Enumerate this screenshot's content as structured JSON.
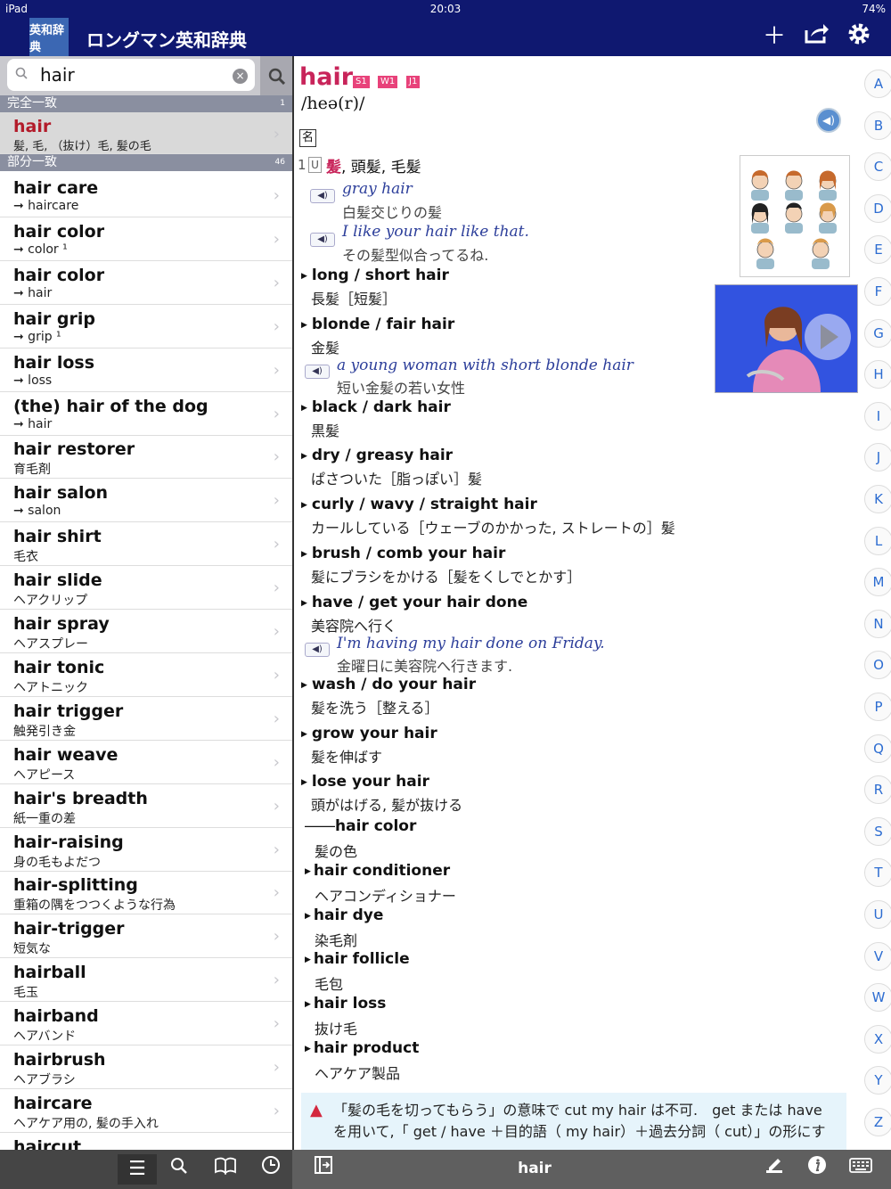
{
  "status": {
    "device": "iPad",
    "time": "20:03",
    "battery": "74%"
  },
  "nav": {
    "logo": "英和辞典",
    "title": "ロングマン英和辞典"
  },
  "search": {
    "value": "hair"
  },
  "sections": {
    "exact": {
      "label": "完全一致",
      "count": "1"
    },
    "partial": {
      "label": "部分一致",
      "count": "46"
    }
  },
  "exact_item": {
    "word": "hair",
    "meaning": "髪, 毛, （抜け）毛, 髪の毛"
  },
  "list": [
    {
      "word": "hair care",
      "meaning": "➞ haircare"
    },
    {
      "word": "hair color",
      "meaning": "➞ color ¹"
    },
    {
      "word": "hair color",
      "meaning": "➞ hair"
    },
    {
      "word": "hair grip",
      "meaning": "➞ grip ¹"
    },
    {
      "word": "hair loss",
      "meaning": "➞ loss"
    },
    {
      "word": "(the) hair of the dog",
      "meaning": "➞ hair"
    },
    {
      "word": "hair restorer",
      "meaning": "育毛剤"
    },
    {
      "word": "hair salon",
      "meaning": "➞ salon"
    },
    {
      "word": "hair shirt",
      "meaning": "毛衣"
    },
    {
      "word": "hair slide",
      "meaning": "ヘアクリップ"
    },
    {
      "word": "hair spray",
      "meaning": "ヘアスプレー"
    },
    {
      "word": "hair tonic",
      "meaning": "ヘアトニック"
    },
    {
      "word": "hair trigger",
      "meaning": "触発引き金"
    },
    {
      "word": "hair weave",
      "meaning": "ヘアピース"
    },
    {
      "word": "hair's breadth",
      "meaning": "紙一重の差"
    },
    {
      "word": "hair-raising",
      "meaning": "身の毛もよだつ"
    },
    {
      "word": "hair-splitting",
      "meaning": "重箱の隅をつつくような行為"
    },
    {
      "word": "hair-trigger",
      "meaning": "短気な"
    },
    {
      "word": "hairball",
      "meaning": "毛玉"
    },
    {
      "word": "hairband",
      "meaning": "ヘアバンド"
    },
    {
      "word": "hairbrush",
      "meaning": "ヘアブラシ"
    },
    {
      "word": "haircare",
      "meaning": "ヘアケア用の, 髪の手入れ"
    },
    {
      "word": "haircut",
      "meaning": ""
    }
  ],
  "entry": {
    "headword": "hair",
    "badges": [
      "S1",
      "W1",
      "J1"
    ],
    "pron": "/heə(r)/",
    "pos": "名",
    "sense_num": "1",
    "sense_u": "U",
    "sense_key": "髪",
    "sense_rest": ", 頭髪, 毛髪",
    "ex1_en": "gray hair",
    "ex1_jp": "白髪交じりの髪",
    "ex2_en": "I like your hair like that.",
    "ex2_jp": "その髪型似合ってるね.",
    "phrases": [
      {
        "en": "long / short hair",
        "jp": "長髪［短髪］"
      },
      {
        "en": "blonde / fair hair",
        "jp": "金髪"
      },
      {
        "en": "black / dark hair",
        "jp": "黒髪"
      },
      {
        "en": "dry / greasy hair",
        "jp": "ぱさついた［脂っぽい］髪"
      },
      {
        "en": "curly / wavy / straight hair",
        "jp": "カールしている［ウェーブのかかった, ストレートの］髪"
      },
      {
        "en": "brush / comb your hair",
        "jp": "髪にブラシをかける［髪をくしでとかす］"
      },
      {
        "en": "have / get your hair done",
        "jp": "美容院へ行く"
      },
      {
        "en": "wash / do your hair",
        "jp": "髪を洗う［整える］"
      },
      {
        "en": "grow your hair",
        "jp": "髪を伸ばす"
      },
      {
        "en": "lose your hair",
        "jp": "頭がはげる, 髪が抜ける"
      }
    ],
    "ex3_en": "a young woman with short blonde hair",
    "ex3_jp": "短い金髪の若い女性",
    "ex4_en": "I'm having my hair done on Friday.",
    "ex4_jp": "金曜日に美容院へ行きます.",
    "compound_dash": "――",
    "compounds": [
      {
        "en": "hair color",
        "jp": "髪の色"
      },
      {
        "en": "hair conditioner",
        "jp": "ヘアコンディショナー"
      },
      {
        "en": "hair dye",
        "jp": "染毛剤"
      },
      {
        "en": "hair follicle",
        "jp": "毛包"
      },
      {
        "en": "hair loss",
        "jp": "抜け毛"
      },
      {
        "en": "hair product",
        "jp": "ヘアケア製品"
      }
    ],
    "note_l1": "「髪の毛を切ってもらう」の意味で cut my hair は不可.　get または have",
    "note_l2": "を用いて,「 get / have ＋目的語（ my hair）＋過去分詞（ cut）」の形にす"
  },
  "bottom": {
    "word": "hair"
  },
  "alphabet": [
    "A",
    "B",
    "C",
    "D",
    "E",
    "F",
    "G",
    "H",
    "I",
    "J",
    "K",
    "L",
    "M",
    "N",
    "O",
    "P",
    "Q",
    "R",
    "S",
    "T",
    "U",
    "V",
    "W",
    "X",
    "Y",
    "Z"
  ]
}
